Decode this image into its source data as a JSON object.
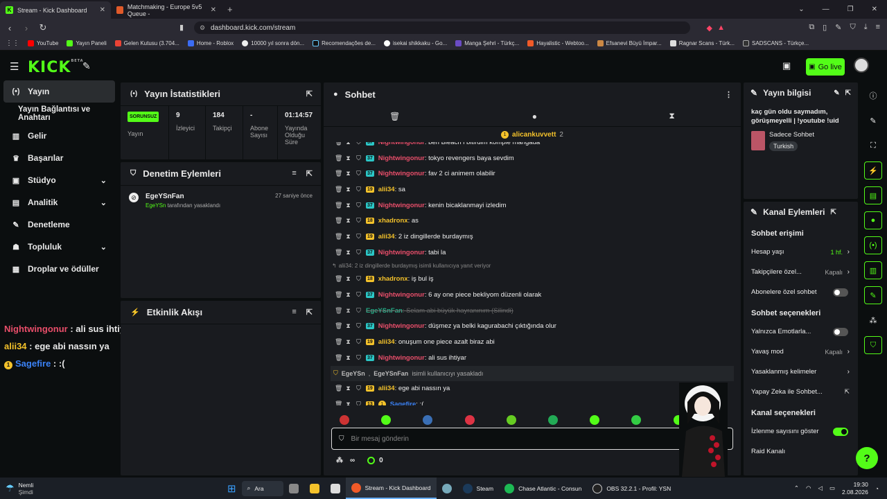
{
  "browser": {
    "tabs": [
      {
        "title": "Stream - Kick Dashboard",
        "active": true
      },
      {
        "title": "Matchmaking - Europe 5v5 Queue - ",
        "active": false
      }
    ],
    "url": "dashboard.kick.com/stream",
    "bookmarks": [
      "YouTube",
      "Yayın Paneli",
      "Gelen Kutusu (3.704...",
      "Home - Roblox",
      "10000 yıl sonra dön...",
      "Recomendações de...",
      "isekai shikkaku - Go...",
      "Manga Şehri - Türkç...",
      "Hayalistic - Webtoo...",
      "Efsanevi Büyü İmpar...",
      "Ragnar Scans - Türk...",
      "SADSCANS - Türkçe..."
    ]
  },
  "header": {
    "logo": "KICK",
    "logo_beta": "BETA",
    "go_live": "Go live"
  },
  "nav": [
    {
      "label": "Yayın",
      "icon": "broadcast-icon",
      "glyph": "(•)",
      "active": true
    },
    {
      "label": "Yayın Bağlantısı ve Anahtarı",
      "icon": "",
      "glyph": ""
    },
    {
      "label": "Gelir",
      "icon": "revenue-icon",
      "glyph": "▥"
    },
    {
      "label": "Başarılar",
      "icon": "trophy-icon",
      "glyph": "♛"
    },
    {
      "label": "Stüdyo",
      "icon": "studio-icon",
      "glyph": "▣",
      "chevron": true
    },
    {
      "label": "Analitik",
      "icon": "analytics-icon",
      "glyph": "▤",
      "chevron": true
    },
    {
      "label": "Denetleme",
      "icon": "wrench-icon",
      "glyph": "✎"
    },
    {
      "label": "Topluluk",
      "icon": "community-icon",
      "glyph": "☗",
      "chevron": true
    },
    {
      "label": "Droplar ve ödüller",
      "icon": "drops-icon",
      "glyph": "▦"
    }
  ],
  "overlay_chat": [
    {
      "user": "Nightwingonur",
      "text": " : ali sus ihtiyar",
      "color": "#e94e6a"
    },
    {
      "user": "alii34",
      "text": " : ege abi nassın ya",
      "color": "#f4c22b"
    },
    {
      "user": "Sagefire",
      "text": " : :(",
      "color": "#3b82f6",
      "badge": "1"
    }
  ],
  "stats": {
    "title": "Yayın İstatistikleri",
    "status_badge": "SORUNSUZ",
    "status_label": "Yayın",
    "viewers": "9",
    "viewers_label": "İzleyici",
    "followers": "184",
    "followers_label": "Takipçi",
    "subs": "-",
    "subs_label": "Abone Sayısı",
    "uptime": "01:14:57",
    "uptime_label": "Yayında Olduğu Süre"
  },
  "moderation": {
    "title": "Denetim Eylemleri",
    "entry_user": "EgeYSnFan",
    "entry_time": "27 saniye önce",
    "entry_by": "EgeYSn",
    "entry_action": " tarafından yasaklandı"
  },
  "activity": {
    "title": "Etkinlik Akışı"
  },
  "chat": {
    "title": "Sohbet",
    "pinned_user": "alicankuvvett",
    "pinned_count": "2",
    "messages": [
      {
        "user": "Nightwingonur",
        "color": "#e94e6a",
        "badge": "37",
        "badge_class": "teal",
        "text": ": ben Bleach i bitirdim komple mangada"
      },
      {
        "user": "Nightwingonur",
        "color": "#e94e6a",
        "badge": "37",
        "badge_class": "teal",
        "text": ": tokyo revengers baya sevdim"
      },
      {
        "user": "Nightwingonur",
        "color": "#e94e6a",
        "badge": "37",
        "badge_class": "teal",
        "text": ": fav 2 ci animem olabilir"
      },
      {
        "user": "alii34",
        "color": "#f4c22b",
        "badge": "19",
        "badge_class": "gold",
        "text": ": sa"
      },
      {
        "user": "Nightwingonur",
        "color": "#e94e6a",
        "badge": "37",
        "badge_class": "teal",
        "text": ": kenin bicaklanmayi izledim"
      },
      {
        "user": "xhadronx",
        "color": "#f4c22b",
        "badge": "18",
        "badge_class": "gold",
        "text": ": as"
      },
      {
        "user": "alii34",
        "color": "#f4c22b",
        "badge": "19",
        "badge_class": "gold",
        "text": ": 2 iz dingillerde burdaymış"
      },
      {
        "user": "Nightwingonur",
        "color": "#e94e6a",
        "badge": "37",
        "badge_class": "teal",
        "text": ": tabi la"
      }
    ],
    "reply_note": "alii34: 2 iz dingillerde burdaymış isimli kullanıcıya yanıt veriyor",
    "messages2": [
      {
        "user": "xhadronx",
        "color": "#f4c22b",
        "badge": "18",
        "badge_class": "gold",
        "text": ": iş bul iş"
      },
      {
        "user": "Nightwingonur",
        "color": "#e94e6a",
        "badge": "37",
        "badge_class": "teal",
        "text": ": 6 ay one piece bekliyom düzenli olarak"
      },
      {
        "user": "EgeYSnFan",
        "color": "#2bc69a",
        "badge": "",
        "badge_class": "",
        "text": ": Selam abi büyük hayranınım (Silindi)",
        "deleted": true
      },
      {
        "user": "Nightwingonur",
        "color": "#e94e6a",
        "badge": "37",
        "badge_class": "teal",
        "text": ": düşmez ya belki kagurabachi çıktığında olur"
      },
      {
        "user": "alii34",
        "color": "#f4c22b",
        "badge": "19",
        "badge_class": "gold",
        "text": ": onuşum one piece azalt biraz abi"
      },
      {
        "user": "Nightwingonur",
        "color": "#e94e6a",
        "badge": "37",
        "badge_class": "teal",
        "text": ": ali sus ihtiyar"
      }
    ],
    "ban_by": "EgeYSn",
    "ban_sep": ", ",
    "ban_user": "EgeYSnFan",
    "ban_text": " isimli kullanıcıyı yasakladı",
    "messages3": [
      {
        "user": "alii34",
        "color": "#f4c22b",
        "badge": "19",
        "badge_class": "gold",
        "text": ": ege abi nassın ya"
      },
      {
        "user": "Sagefire",
        "color": "#3b82f6",
        "badge": "13",
        "badge_class": "gold",
        "text": ": :(",
        "badge2": "1"
      }
    ],
    "input_placeholder": "Bir mesaj gönderin",
    "points": "0"
  },
  "info": {
    "title": "Yayın bilgisi",
    "stream_title": "kaç gün oldu saymadım, görüşmeyelli | !youtube !uid",
    "category": "Sadece Sohbet",
    "tag": "Turkish"
  },
  "channel": {
    "title": "Kanal Eylemleri",
    "chat_access": "Sohbet erişimi",
    "account_age": "Hesap yaşı",
    "account_age_val": "1 hf.",
    "followers_only": "Takipçilere özel...",
    "followers_only_val": "Kapalı",
    "subs_only": "Abonelere özel sohbet",
    "chat_options": "Sohbet seçenekleri",
    "emotes_only": "Yalnızca Emotlarla...",
    "slow_mode": "Yavaş mod",
    "slow_mode_val": "Kapalı",
    "banned_words": "Yasaklanmış kelimeler",
    "ai_chat": "Yapay Zeka ile Sohbet...",
    "channel_options": "Kanal seçenekleri",
    "show_viewers": "İzlenme sayısını göster",
    "raid": "Raid Kanalı"
  },
  "taskbar": {
    "weather": "Nemli",
    "weather_sub": "Şimdi",
    "search": "Ara",
    "items": [
      "Stream - Kick Dashboard",
      "Steam",
      "Chase Atlantic - Consun",
      "OBS 32.2.1 - Profil: YSN"
    ],
    "time": "19:30",
    "date": "2.08.2026"
  }
}
